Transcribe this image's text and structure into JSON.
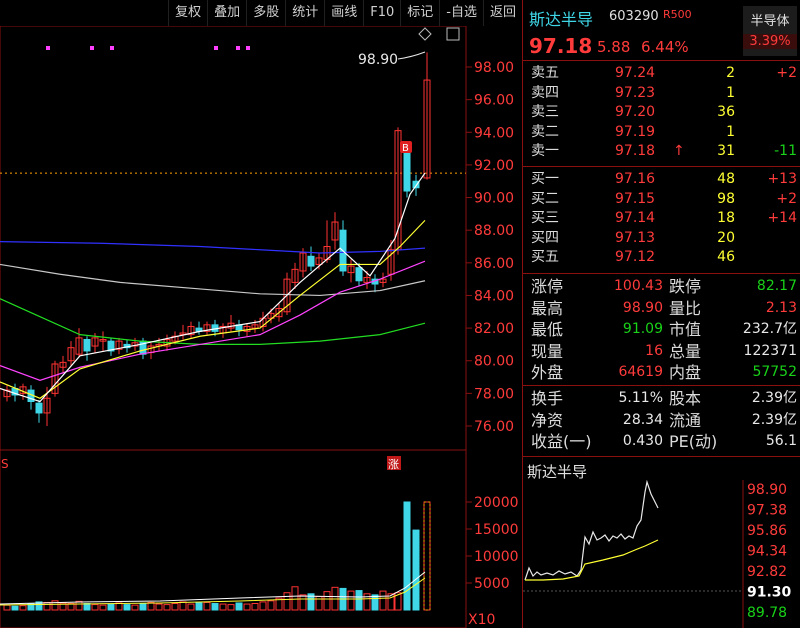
{
  "toolbar": {
    "items": [
      "复权",
      "叠加",
      "多股",
      "统计",
      "画线",
      "F10",
      "标记",
      "-自选",
      "返回"
    ]
  },
  "main_chart": {
    "price_axis": [
      "98.00",
      "96.00",
      "94.00",
      "92.00",
      "90.00",
      "88.00",
      "86.00",
      "84.00",
      "82.00",
      "80.00",
      "78.00",
      "76.00"
    ],
    "high_marker": "98.90",
    "b_marker": "B",
    "limit_marker": "涨",
    "s_marker": "S",
    "colors": {
      "up": "#ff3333",
      "down": "#3fd7e8",
      "ma5": "#ffffff",
      "ma10": "#ffff33",
      "ma20": "#ff44ff",
      "ma60": "#22dd22",
      "ma120": "#3030ff",
      "ma250": "#c8c8c8"
    }
  },
  "volume_chart": {
    "axis": [
      "20000",
      "15000",
      "10000",
      "5000"
    ],
    "unit": "X10"
  },
  "stock": {
    "name": "斯达半导",
    "code": "603290",
    "tag": "R500",
    "price": "97.18",
    "change": "5.88",
    "change_pct": "6.44%",
    "sector": "半导体",
    "sector_pct": "3.39%"
  },
  "asks": [
    {
      "label": "卖五",
      "price": "97.24",
      "vol": "2",
      "chg": "+2"
    },
    {
      "label": "卖四",
      "price": "97.23",
      "vol": "1",
      "chg": ""
    },
    {
      "label": "卖三",
      "price": "97.20",
      "vol": "36",
      "chg": ""
    },
    {
      "label": "卖二",
      "price": "97.19",
      "vol": "1",
      "chg": ""
    },
    {
      "label": "卖一",
      "price": "97.18",
      "arrow": "↑",
      "vol": "31",
      "chg": "-11"
    }
  ],
  "bids": [
    {
      "label": "买一",
      "price": "97.16",
      "vol": "48",
      "chg": "+13"
    },
    {
      "label": "买二",
      "price": "97.15",
      "vol": "98",
      "chg": "+2"
    },
    {
      "label": "买三",
      "price": "97.14",
      "vol": "18",
      "chg": "+14"
    },
    {
      "label": "买四",
      "price": "97.13",
      "vol": "20",
      "chg": ""
    },
    {
      "label": "买五",
      "price": "97.12",
      "vol": "46",
      "chg": ""
    }
  ],
  "stats": [
    {
      "l1": "涨停",
      "v1": "100.43",
      "c1": "red",
      "l2": "跌停",
      "v2": "82.17",
      "c2": "green"
    },
    {
      "l1": "最高",
      "v1": "98.90",
      "c1": "red",
      "l2": "量比",
      "v2": "2.13",
      "c2": "red"
    },
    {
      "l1": "最低",
      "v1": "91.09",
      "c1": "green",
      "l2": "市值",
      "v2": "232.7亿",
      "c2": "white"
    },
    {
      "l1": "现量",
      "v1": "16",
      "c1": "red",
      "l2": "总量",
      "v2": "122371",
      "c2": "white"
    },
    {
      "l1": "外盘",
      "v1": "64619",
      "c1": "red",
      "l2": "内盘",
      "v2": "57752",
      "c2": "green"
    }
  ],
  "fundamentals": [
    {
      "l1": "换手",
      "v1": "5.11%",
      "l2": "股本",
      "v2": "2.39亿"
    },
    {
      "l1": "净资",
      "v1": "28.34",
      "l2": "流通",
      "v2": "2.39亿"
    },
    {
      "l1": "收益(一)",
      "v1": "0.430",
      "l2": "PE(动)",
      "v2": "56.1"
    }
  ],
  "mini_chart": {
    "title": "斯达半导",
    "axis": [
      {
        "v": "98.90",
        "c": "red"
      },
      {
        "v": "97.38",
        "c": "red"
      },
      {
        "v": "95.86",
        "c": "red"
      },
      {
        "v": "94.34",
        "c": "red"
      },
      {
        "v": "92.82",
        "c": "red"
      },
      {
        "v": "91.30",
        "c": "white"
      },
      {
        "v": "89.78",
        "c": "green"
      }
    ]
  }
}
